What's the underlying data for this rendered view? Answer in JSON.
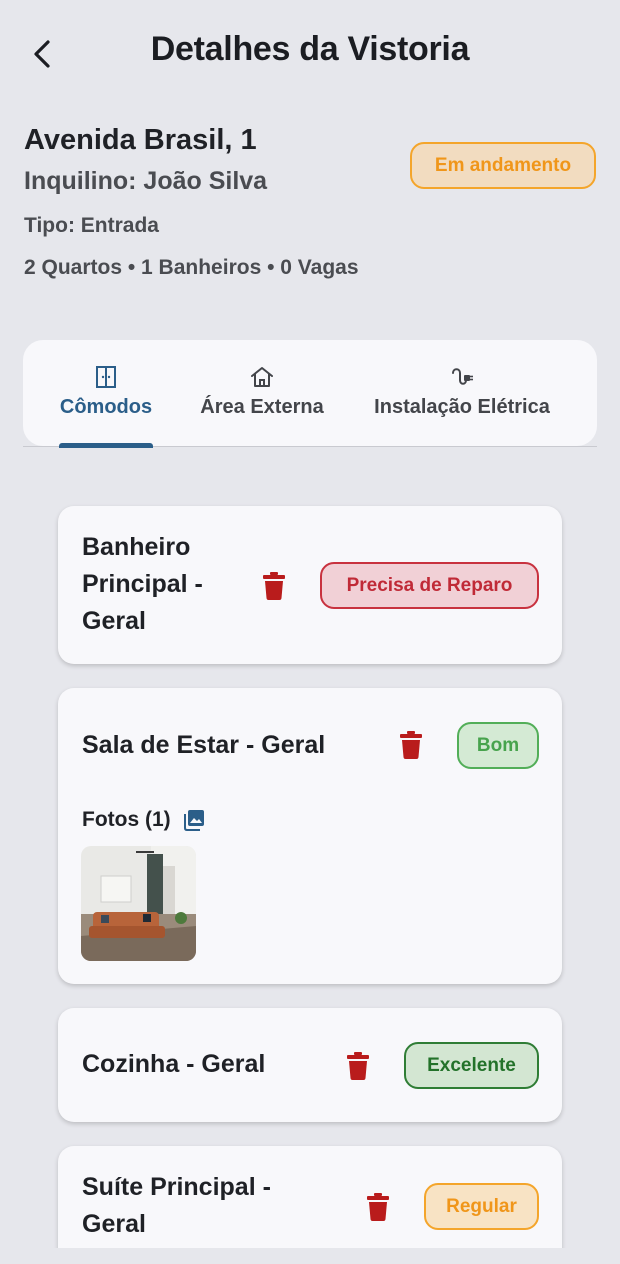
{
  "header": {
    "title": "Detalhes da Vistoria",
    "back_icon": "chevron-left-icon"
  },
  "property": {
    "address": "Avenida Brasil, 1",
    "tenant": "Inquilino: João Silva",
    "type": "Tipo: Entrada",
    "counts": "2 Quartos • 1 Banheiros • 0 Vagas",
    "status": "Em andamento"
  },
  "tabs": [
    {
      "label": "Cômodos",
      "icon": "door-icon",
      "active": true
    },
    {
      "label": "Área Externa",
      "icon": "house-icon",
      "active": false
    },
    {
      "label": "Instalação Elétrica",
      "icon": "plug-icon",
      "active": false
    }
  ],
  "rooms": [
    {
      "title": "Banheiro Principal - Geral",
      "condition": "Precisa de Reparo"
    },
    {
      "title": "Sala de Estar - Geral",
      "condition": "Bom",
      "photos_label": "Fotos (1)"
    },
    {
      "title": "Cozinha - Geral",
      "condition": "Excelente"
    },
    {
      "title": "Suíte Principal - Geral",
      "condition": "Regular"
    }
  ],
  "colors": {
    "accent": "#2b5e89",
    "status_in_progress": "#f0961a",
    "condition_repair": "#c02a37",
    "condition_good": "#47a34d",
    "condition_excellent": "#23722a",
    "condition_regular": "#f0961a",
    "trash": "#b91c1c"
  }
}
